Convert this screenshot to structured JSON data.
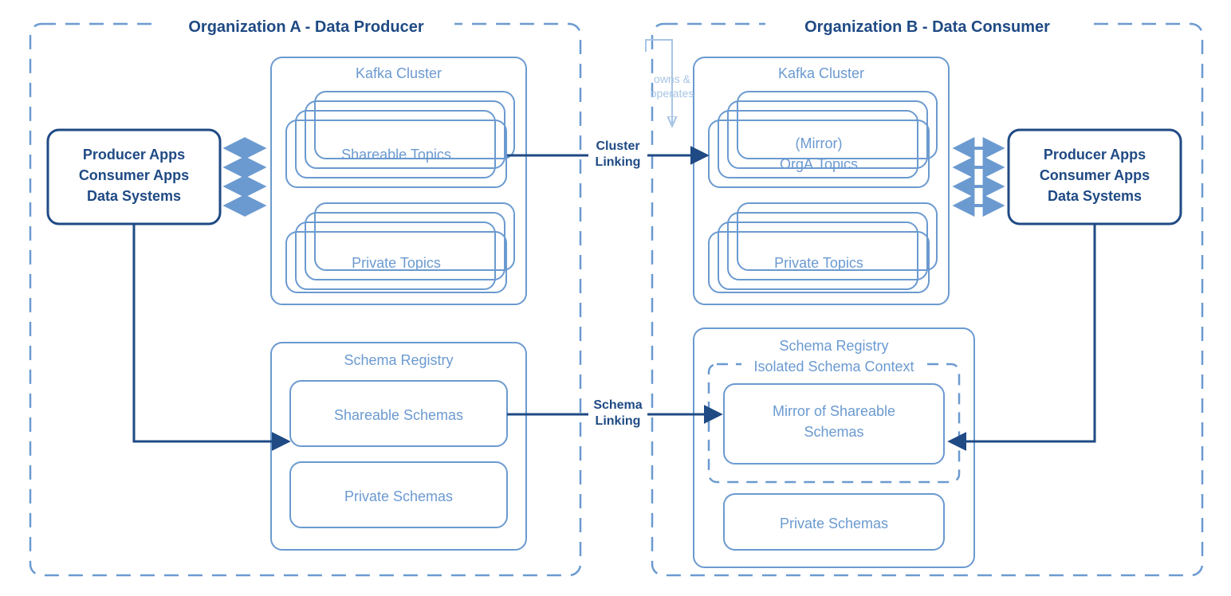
{
  "orgA": {
    "title": "Organization A - Data Producer",
    "apps": {
      "l1": "Producer Apps",
      "l2": "Consumer Apps",
      "l3": "Data Systems"
    },
    "kafka": {
      "title": "Kafka Cluster",
      "shareable": "Shareable Topics",
      "private": "Private Topics"
    },
    "registry": {
      "title": "Schema Registry",
      "shareable": "Shareable Schemas",
      "private": "Private Schemas"
    }
  },
  "orgB": {
    "title": "Organization B - Data Consumer",
    "apps": {
      "l1": "Producer Apps",
      "l2": "Consumer Apps",
      "l3": "Data Systems"
    },
    "kafka": {
      "title": "Kafka Cluster",
      "mirror1": "(Mirror)",
      "mirror2": "OrgA.Topics",
      "private": "Private Topics"
    },
    "registry": {
      "title": "Schema Registry",
      "context": "Isolated Schema Context",
      "mirror1": "Mirror of Shareable",
      "mirror2": "Schemas",
      "private": "Private Schemas"
    }
  },
  "links": {
    "cluster": "Cluster Linking",
    "schema": "Schema Linking",
    "owns1": "owns &",
    "owns2": "operates"
  }
}
